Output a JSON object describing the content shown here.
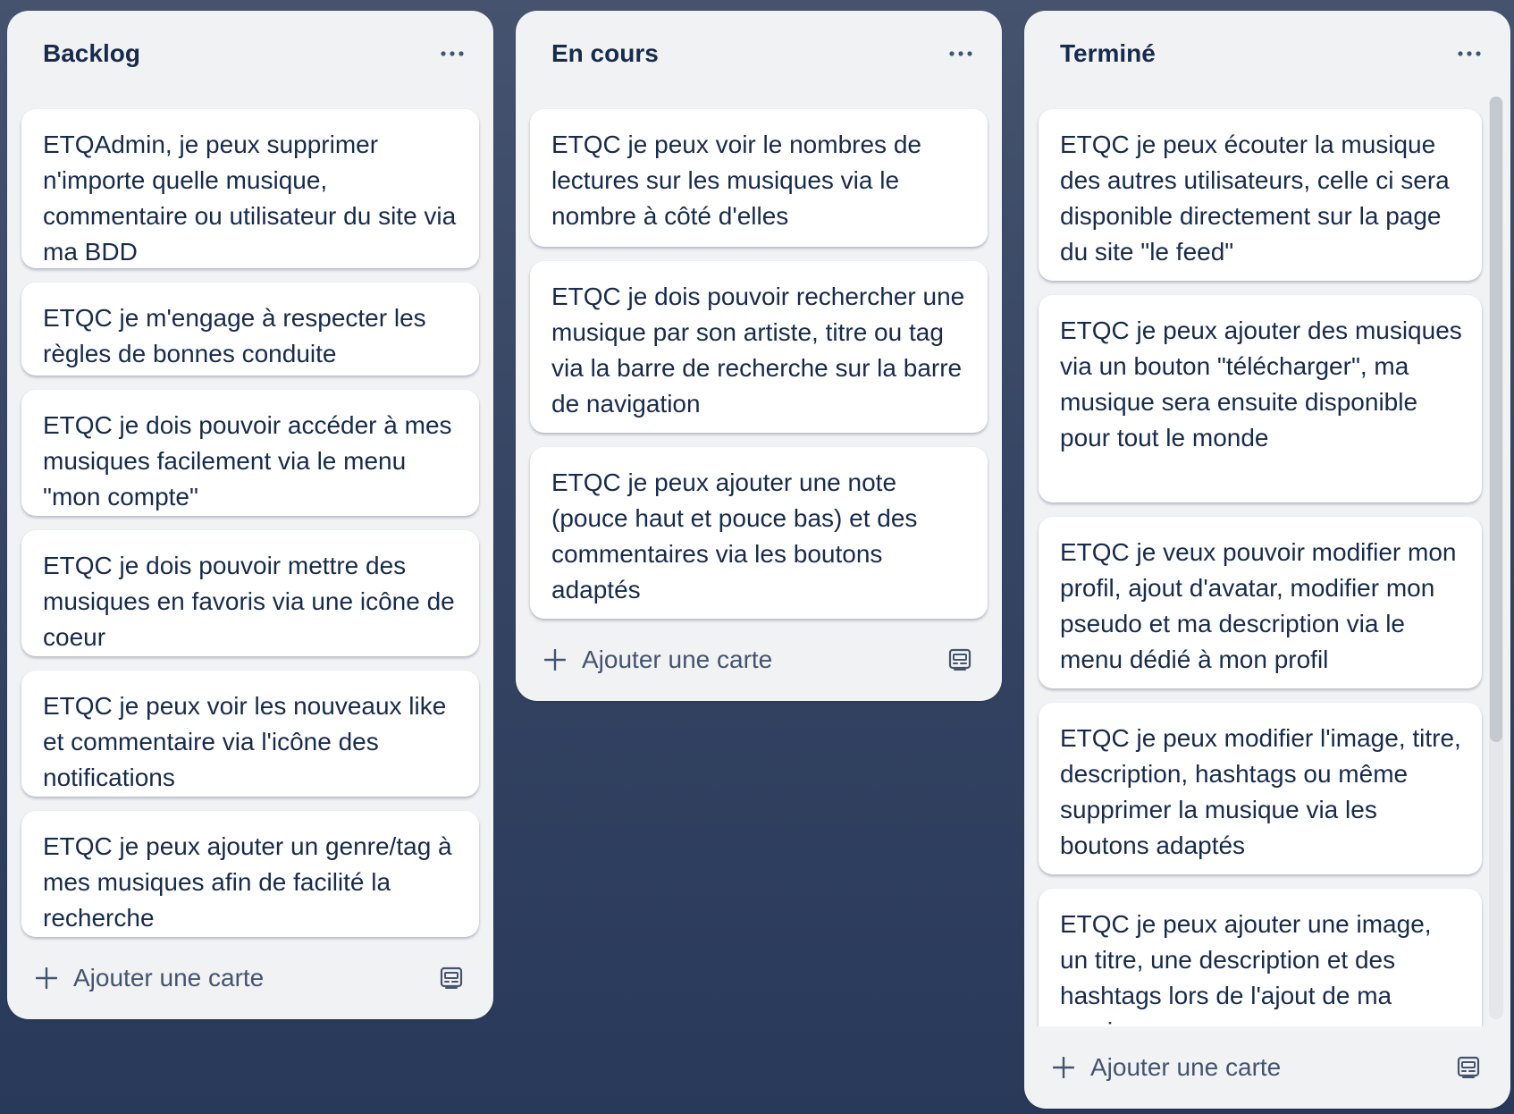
{
  "board": {
    "lists": [
      {
        "title": "Backlog",
        "cards": [
          "ETQAdmin, je peux supprimer n'importe quelle musique, commentaire ou utilisateur du site via ma BDD",
          "ETQC je m'engage à respecter les règles de bonnes conduite",
          "ETQC je dois pouvoir accéder à mes musiques facilement via le menu \"mon compte\"",
          "ETQC je dois pouvoir mettre des musiques en favoris via une icône de coeur",
          "ETQC je peux voir les nouveaux like et commentaire via l'icône des notifications",
          "ETQC je peux ajouter un genre/tag à mes musiques afin de facilité la recherche"
        ],
        "add_label": "Ajouter une carte"
      },
      {
        "title": "En cours",
        "cards": [
          "ETQC je peux voir le nombres de lectures sur les musiques via le nombre à côté d'elles",
          "ETQC je dois pouvoir rechercher une musique par son artiste, titre ou tag via la barre de recherche sur la barre de navigation",
          "ETQC je peux ajouter une note (pouce haut et pouce bas) et des commentaires via les boutons adaptés"
        ],
        "add_label": "Ajouter une carte"
      },
      {
        "title": "Terminé",
        "cards": [
          "ETQC je peux écouter la musique des autres utilisateurs, celle ci sera disponible directement sur la page du site \"le feed\"",
          "ETQC je peux ajouter des musiques via un bouton \"télécharger\", ma musique sera ensuite disponible pour tout le monde",
          "ETQC je veux pouvoir modifier mon profil, ajout d'avatar, modifier mon pseudo et ma description via le menu dédié à mon profil",
          "ETQC je peux modifier l'image, titre, description, hashtags ou même supprimer la musique via les boutons adaptés",
          "ETQC je peux ajouter une image, un titre, une description et des hashtags lors de l'ajout de ma musique"
        ],
        "add_label": "Ajouter une carte"
      }
    ]
  },
  "icons": {
    "list_menu": "more-horizontal-icon",
    "add": "plus-icon",
    "template": "card-template-icon"
  },
  "colors": {
    "text": "#172b4d",
    "muted": "#44546f",
    "list_bg": "#f1f2f4",
    "card_bg": "#ffffff"
  }
}
